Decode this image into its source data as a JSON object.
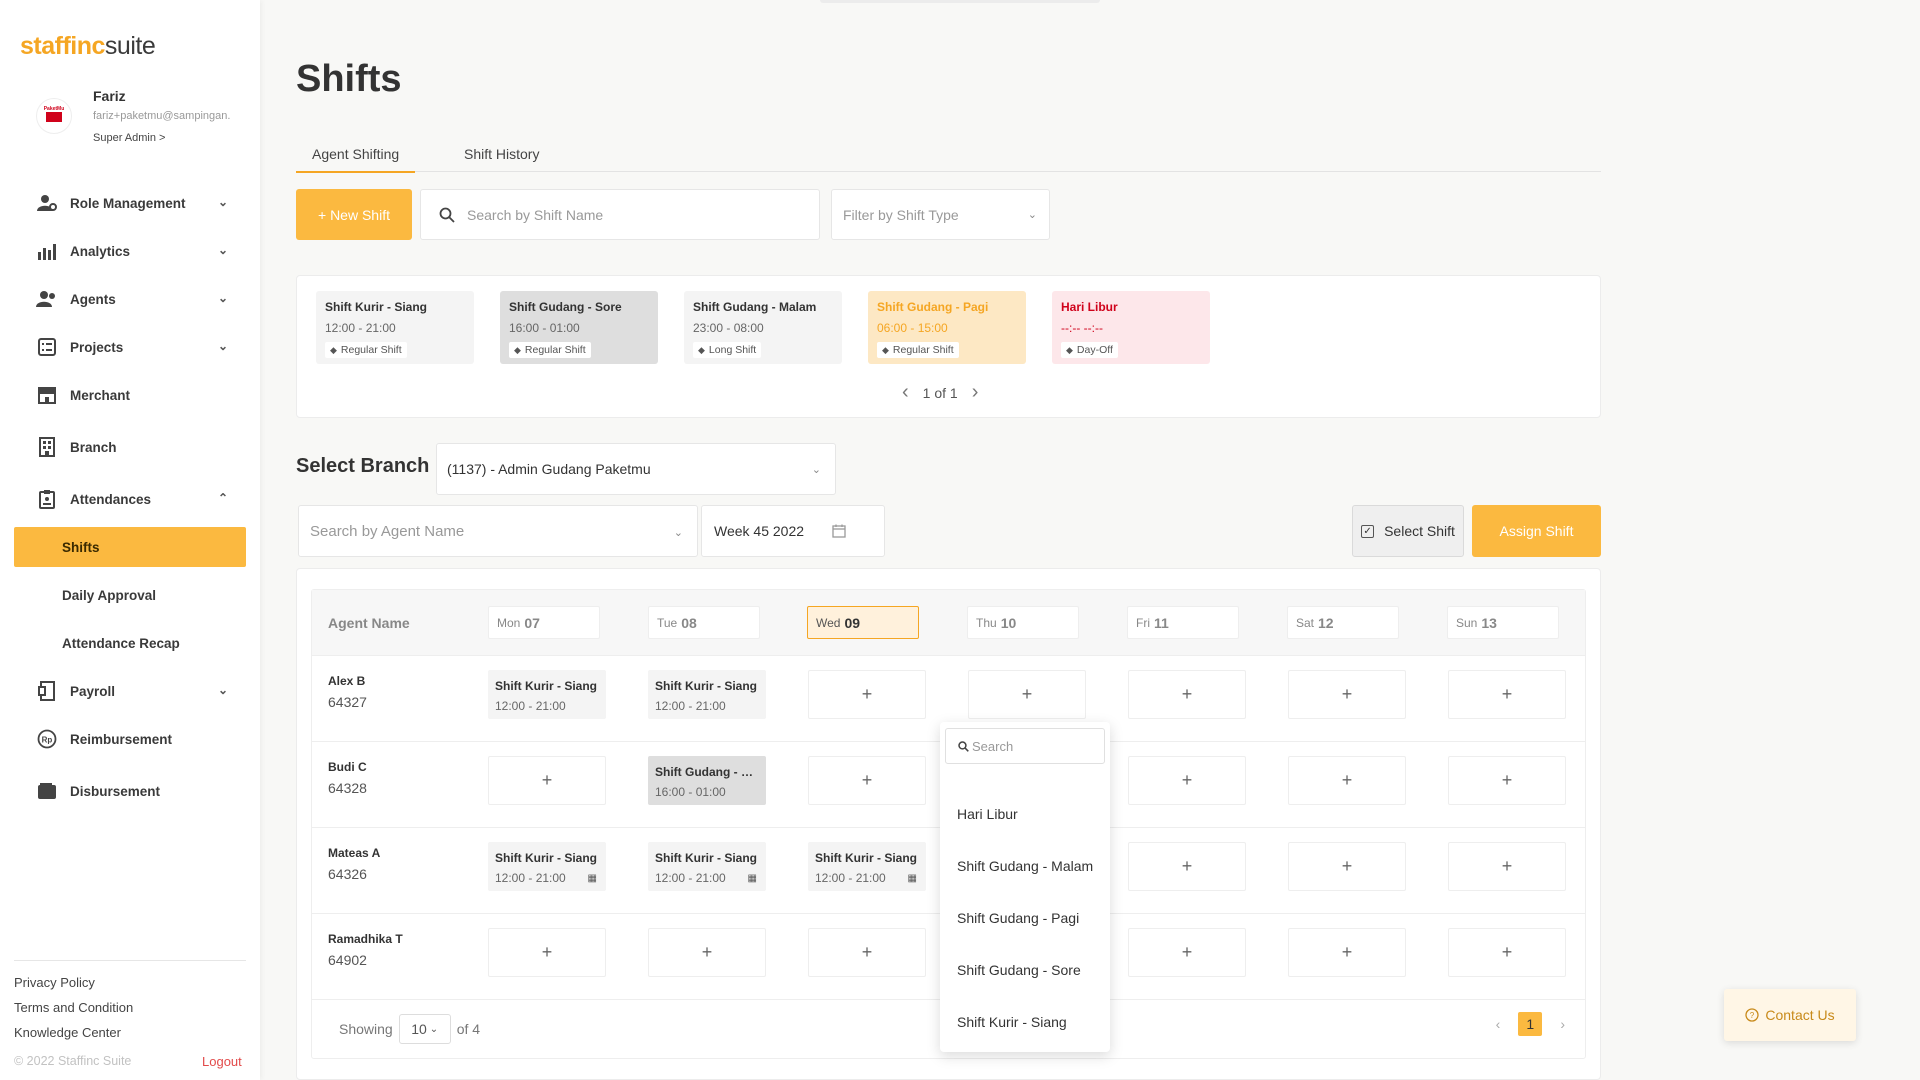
{
  "brand": {
    "part1": "staff",
    "mid": "inc",
    "part2": "suite"
  },
  "user": {
    "name": "Fariz",
    "email": "fariz+paketmu@sampingan.",
    "role": "Super Admin >",
    "avatar_text": "PaketMu"
  },
  "nav": {
    "role_management": "Role Management",
    "analytics": "Analytics",
    "agents": "Agents",
    "projects": "Projects",
    "merchant": "Merchant",
    "branch": "Branch",
    "attendances": "Attendances",
    "shifts": "Shifts",
    "daily_approval": "Daily Approval",
    "attendance_recap": "Attendance Recap",
    "payroll": "Payroll",
    "reimbursement": "Reimbursement",
    "disbursement": "Disbursement"
  },
  "footer": {
    "privacy": "Privacy Policy",
    "terms": "Terms and Condition",
    "knowledge": "Knowledge Center",
    "copyright": "© 2022 Staffinc Suite",
    "logout": "Logout"
  },
  "page": {
    "title": "Shifts"
  },
  "tabs": {
    "agent_shifting": "Agent Shifting",
    "shift_history": "Shift History"
  },
  "toolbar": {
    "new_shift": "+  New Shift",
    "search_placeholder": "Search by Shift Name",
    "filter_placeholder": "Filter by Shift Type"
  },
  "shift_cards": [
    {
      "name": "Shift Kurir - Siang",
      "time": "12:00 - 21:00",
      "tag": "Regular Shift"
    },
    {
      "name": "Shift Gudang - Sore",
      "time": "16:00 - 01:00",
      "tag": "Regular Shift"
    },
    {
      "name": "Shift Gudang - Malam",
      "time": "23:00 - 08:00",
      "tag": "Long Shift"
    },
    {
      "name": "Shift Gudang - Pagi",
      "time": "06:00 - 15:00",
      "tag": "Regular Shift"
    },
    {
      "name": "Hari Libur",
      "time": "--:-- --:--",
      "tag": "Day-Off"
    }
  ],
  "shift_pager": {
    "label": "1 of 1"
  },
  "branch": {
    "label": "Select Branch",
    "value": "(1137) - Admin Gudang Paketmu"
  },
  "filters": {
    "agent_placeholder": "Search by Agent Name",
    "week": "Week 45 2022",
    "select_shift": "Select Shift",
    "assign_shift": "Assign Shift"
  },
  "grid": {
    "agent_header": "Agent Name",
    "days": [
      {
        "dow": "Mon",
        "num": "07"
      },
      {
        "dow": "Tue",
        "num": "08"
      },
      {
        "dow": "Wed",
        "num": "09"
      },
      {
        "dow": "Thu",
        "num": "10"
      },
      {
        "dow": "Fri",
        "num": "11"
      },
      {
        "dow": "Sat",
        "num": "12"
      },
      {
        "dow": "Sun",
        "num": "13"
      }
    ],
    "rows": [
      {
        "name": "Alex B",
        "id": "64327",
        "c0n": "Shift Kurir - Siang",
        "c0t": "12:00 - 21:00",
        "c1n": "Shift Kurir - Siang",
        "c1t": "12:00 - 21:00"
      },
      {
        "name": "Budi C",
        "id": "64328",
        "c1n": "Shift Gudang - So...",
        "c1t": "16:00 - 01:00"
      },
      {
        "name": "Mateas A",
        "id": "64326",
        "c0n": "Shift Kurir - Siang",
        "c0t": "12:00 - 21:00",
        "c1n": "Shift Kurir - Siang",
        "c1t": "12:00 - 21:00",
        "c2n": "Shift Kurir - Siang",
        "c2t": "12:00 - 21:00"
      },
      {
        "name": "Ramadhika T",
        "id": "64902"
      }
    ],
    "add_symbol": "+"
  },
  "table_footer": {
    "showing": "Showing",
    "page_size": "10",
    "of_total": "of 4",
    "current_page": "1"
  },
  "dropdown": {
    "search_placeholder": "Search",
    "items": [
      "Hari Libur",
      "Shift Gudang - Malam",
      "Shift Gudang - Pagi",
      "Shift Gudang - Sore",
      "Shift Kurir - Siang"
    ]
  },
  "contact": {
    "label": "Contact Us"
  },
  "colors": {
    "accent": "#fbb940",
    "accent_text": "#f5a623",
    "dayoff_bg": "#fde7ea",
    "dayoff_text": "#d0021b"
  }
}
